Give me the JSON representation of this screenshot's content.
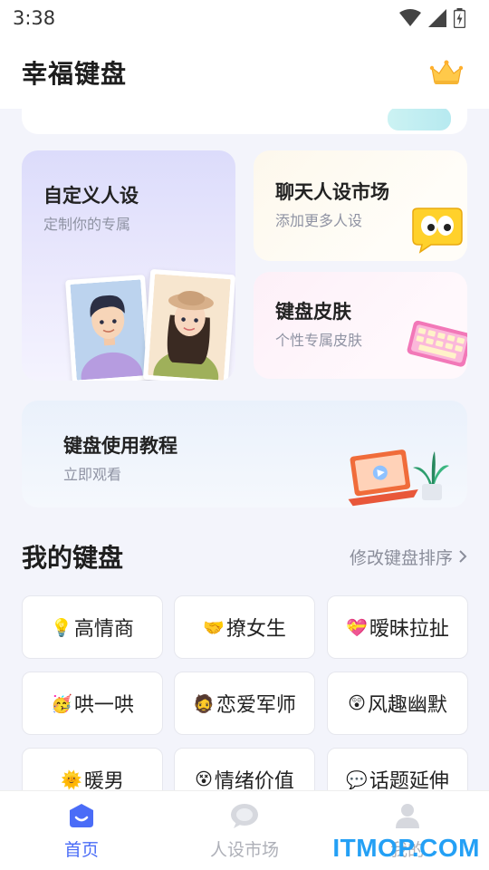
{
  "status_bar": {
    "time": "3:38",
    "icons": [
      "wifi-icon",
      "signal-icon",
      "battery-icon"
    ]
  },
  "header": {
    "title": "幸福键盘",
    "icon": "crown-icon"
  },
  "cards": {
    "custom": {
      "title": "自定义人设",
      "subtitle": "定制你的专属"
    },
    "market": {
      "title": "聊天人设市场",
      "subtitle": "添加更多人设"
    },
    "skin": {
      "title": "键盘皮肤",
      "subtitle": "个性专属皮肤"
    },
    "tutorial": {
      "title": "键盘使用教程",
      "subtitle": "立即观看"
    }
  },
  "my_keyboards": {
    "title": "我的键盘",
    "action": "修改键盘排序",
    "items": [
      {
        "emoji": "💡",
        "label": "高情商"
      },
      {
        "emoji": "🤝",
        "label": "撩女生"
      },
      {
        "emoji": "💝",
        "label": "暧昧拉扯"
      },
      {
        "emoji": "🥳",
        "label": "哄一哄"
      },
      {
        "emoji": "🧔",
        "label": "恋爱军师"
      },
      {
        "emoji": "😲",
        "label": "风趣幽默"
      },
      {
        "emoji": "🌞",
        "label": "暖男"
      },
      {
        "emoji": "😵",
        "label": "情绪价值"
      },
      {
        "emoji": "💬",
        "label": "话题延伸"
      }
    ]
  },
  "bottom_nav": {
    "items": [
      {
        "label": "首页",
        "icon": "home-icon",
        "active": true
      },
      {
        "label": "人设市场",
        "icon": "market-icon",
        "active": false
      },
      {
        "label": "我的",
        "icon": "profile-icon",
        "active": false
      }
    ]
  },
  "watermark": "ITMOP.COM",
  "colors": {
    "accent": "#4a6cf7",
    "background": "#f3f4fb",
    "watermark": "#24a0f5"
  }
}
